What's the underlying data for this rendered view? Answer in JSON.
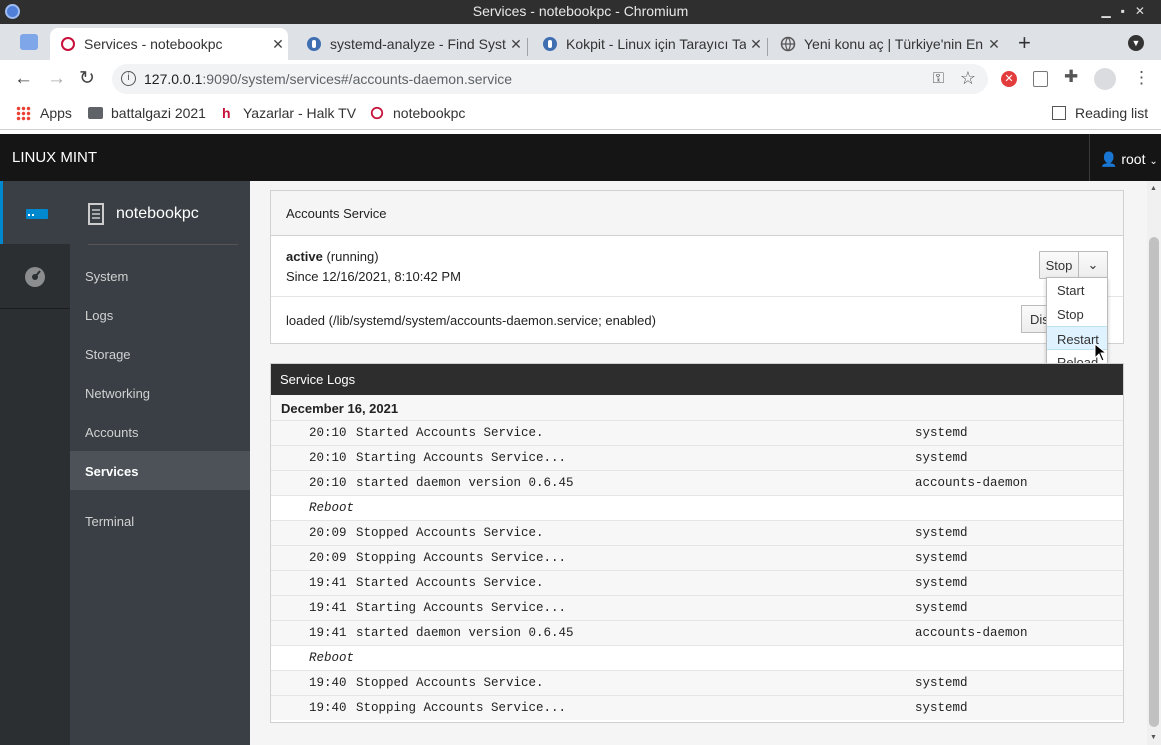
{
  "window": {
    "title": "Services - notebookpc - Chromium"
  },
  "tabs": [
    {
      "label": "Services - notebookpc"
    },
    {
      "label": "systemd-analyze - Find System"
    },
    {
      "label": "Kokpit - Linux için Tarayıcı Tabanlı"
    },
    {
      "label": "Yeni konu aç | Türkiye'nin En"
    }
  ],
  "address": {
    "host": "127.0.0.1",
    "path": ":9090/system/services#/accounts-daemon.service"
  },
  "bookmarks": [
    {
      "label": "Apps"
    },
    {
      "label": "battalgazi 2021"
    },
    {
      "label": "Yazarlar - Halk TV"
    },
    {
      "label": "notebookpc"
    }
  ],
  "reading_list": "Reading list",
  "cockpit": {
    "brand": "LINUX MINT",
    "user": "root",
    "host": "notebookpc",
    "nav": [
      "System",
      "Logs",
      "Storage",
      "Networking",
      "Accounts",
      "Services",
      "Terminal"
    ],
    "selected_nav": "Services"
  },
  "service": {
    "name": "Accounts Service",
    "state": "active",
    "state_detail": "(running)",
    "since": "Since 12/16/2021, 8:10:42 PM",
    "loaded": "loaded (/lib/systemd/system/accounts-daemon.service; enabled)",
    "action_button": "Stop",
    "enable_button": "Dis",
    "menu": [
      "Start",
      "Stop",
      "Restart",
      "Reload"
    ]
  },
  "logs": {
    "title": "Service Logs",
    "date": "December 16, 2021",
    "entries": [
      {
        "time": "20:10",
        "msg": "Started Accounts Service.",
        "src": "systemd"
      },
      {
        "time": "20:10",
        "msg": "Starting Accounts Service...",
        "src": "systemd"
      },
      {
        "time": "20:10",
        "msg": "started daemon version 0.6.45",
        "src": "accounts-daemon"
      },
      {
        "reboot": "Reboot"
      },
      {
        "time": "20:09",
        "msg": "Stopped Accounts Service.",
        "src": "systemd"
      },
      {
        "time": "20:09",
        "msg": "Stopping Accounts Service...",
        "src": "systemd"
      },
      {
        "time": "19:41",
        "msg": "Started Accounts Service.",
        "src": "systemd"
      },
      {
        "time": "19:41",
        "msg": "Starting Accounts Service...",
        "src": "systemd"
      },
      {
        "time": "19:41",
        "msg": "started daemon version 0.6.45",
        "src": "accounts-daemon"
      },
      {
        "reboot": "Reboot"
      },
      {
        "time": "19:40",
        "msg": "Stopped Accounts Service.",
        "src": "systemd"
      },
      {
        "time": "19:40",
        "msg": "Stopping Accounts Service...",
        "src": "systemd"
      }
    ]
  }
}
